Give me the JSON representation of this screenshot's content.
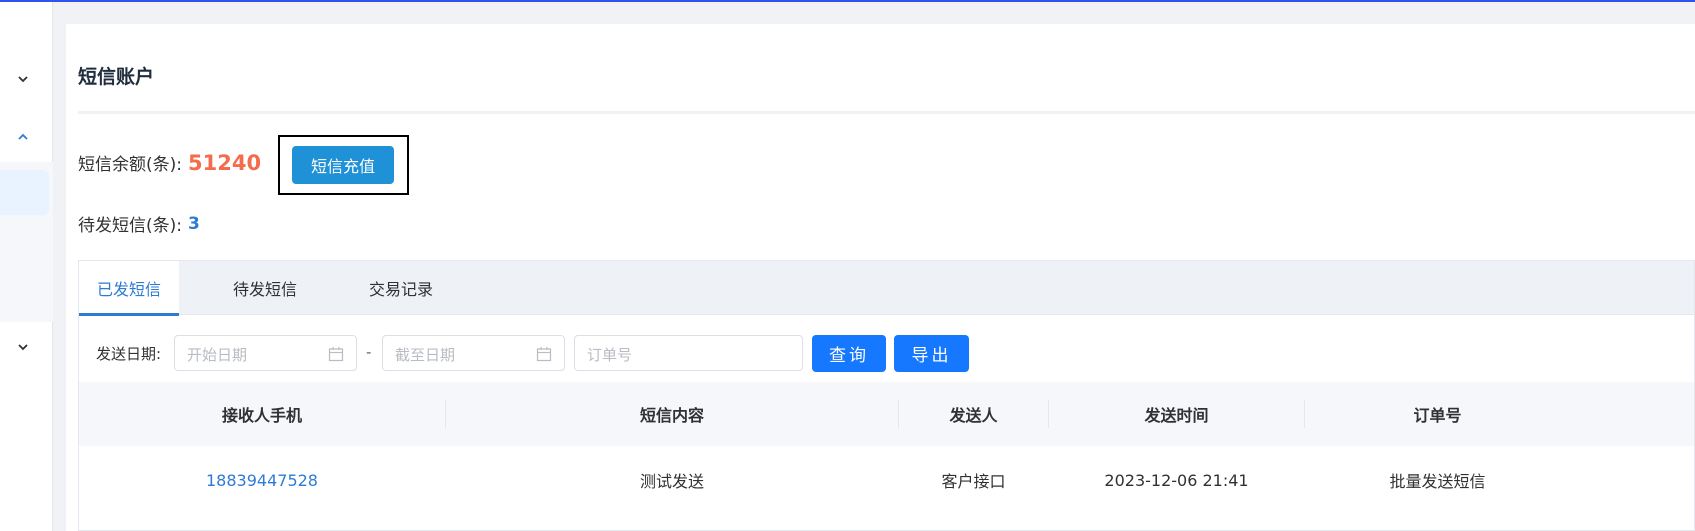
{
  "page": {
    "title": "短信账户"
  },
  "account": {
    "balance_label": "短信余额(条):",
    "balance_value": "51240",
    "recharge_button": "短信充值",
    "pending_label": "待发短信(条):",
    "pending_value": "3"
  },
  "tabs": [
    {
      "label": "已发短信",
      "active": true
    },
    {
      "label": "待发短信",
      "active": false
    },
    {
      "label": "交易记录",
      "active": false
    }
  ],
  "filters": {
    "date_label": "发送日期:",
    "start_placeholder": "开始日期",
    "separator": "-",
    "end_placeholder": "截至日期",
    "order_placeholder": "订单号",
    "query_button": "查询",
    "export_button": "导出"
  },
  "table": {
    "columns": [
      "接收人手机",
      "短信内容",
      "发送人",
      "发送时间",
      "订单号"
    ],
    "rows": [
      [
        "18839447528",
        "测试发送",
        "客户接口",
        "2023-12-06 21:41",
        "批量发送短信"
      ]
    ]
  },
  "colors": {
    "accent": "#1677ff",
    "link": "#2e7bd6",
    "balance": "#f56c4d",
    "recharge": "#1f91d6"
  },
  "icons": [
    "chevron-down-icon",
    "chevron-up-icon",
    "calendar-icon"
  ]
}
